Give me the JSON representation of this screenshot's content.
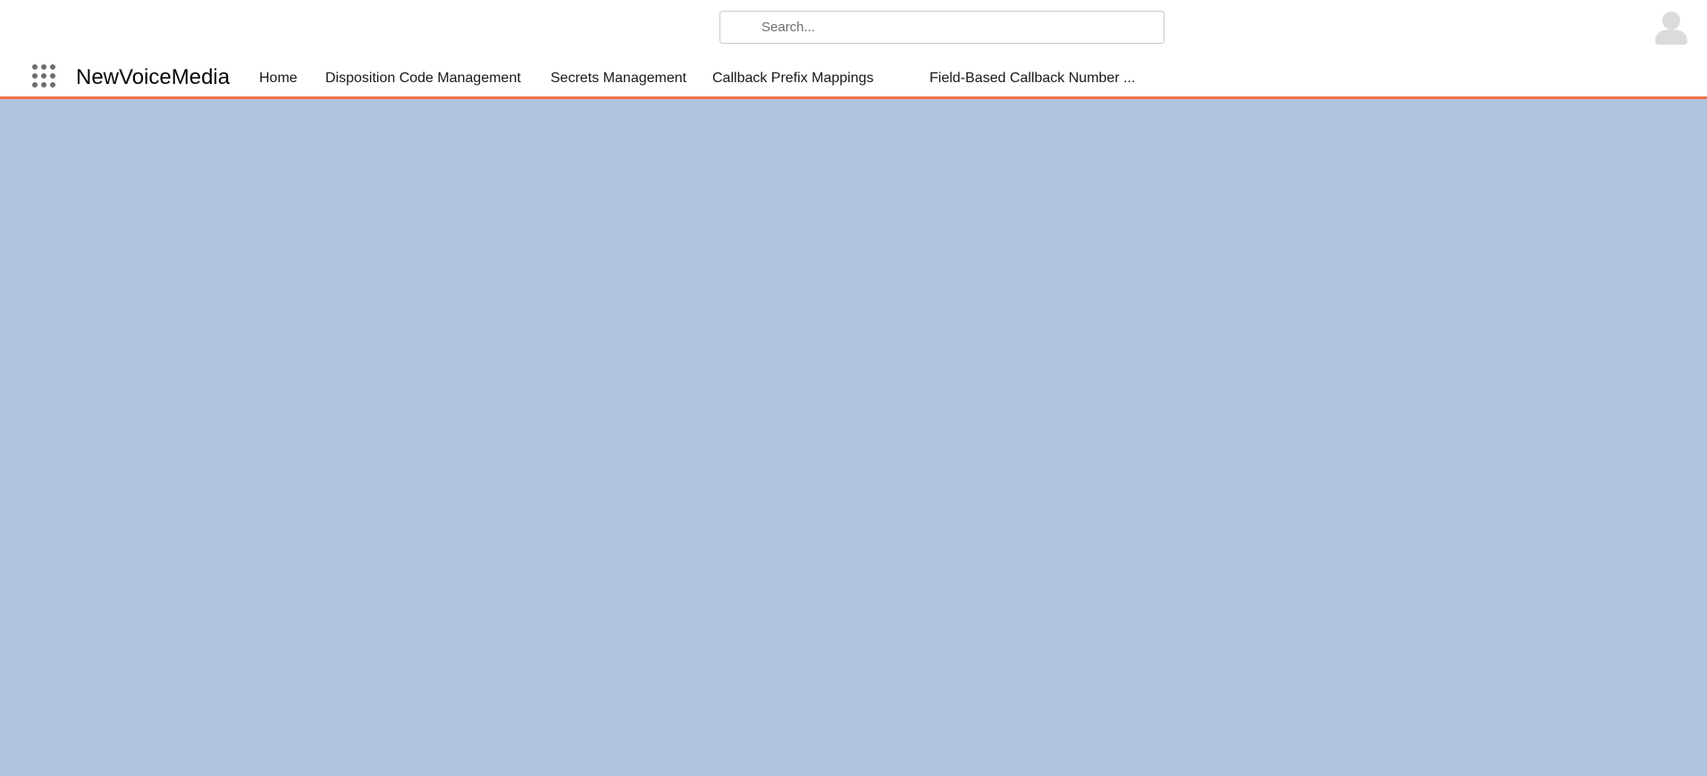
{
  "header": {
    "search": {
      "placeholder": "Search...",
      "value": ""
    },
    "avatar_icon": "user-avatar-icon"
  },
  "nav": {
    "app_launcher_icon": "app-launcher-grid-icon",
    "app_name": "NewVoiceMedia",
    "items": [
      {
        "label": "Home"
      },
      {
        "label": "Disposition Code Management"
      },
      {
        "label": "Secrets Management"
      },
      {
        "label": "Callback Prefix Mappings"
      },
      {
        "label": "Field-Based Callback Number ..."
      }
    ],
    "accent_color": "#f0714a"
  },
  "content": {
    "background_color": "#b0c4de"
  }
}
